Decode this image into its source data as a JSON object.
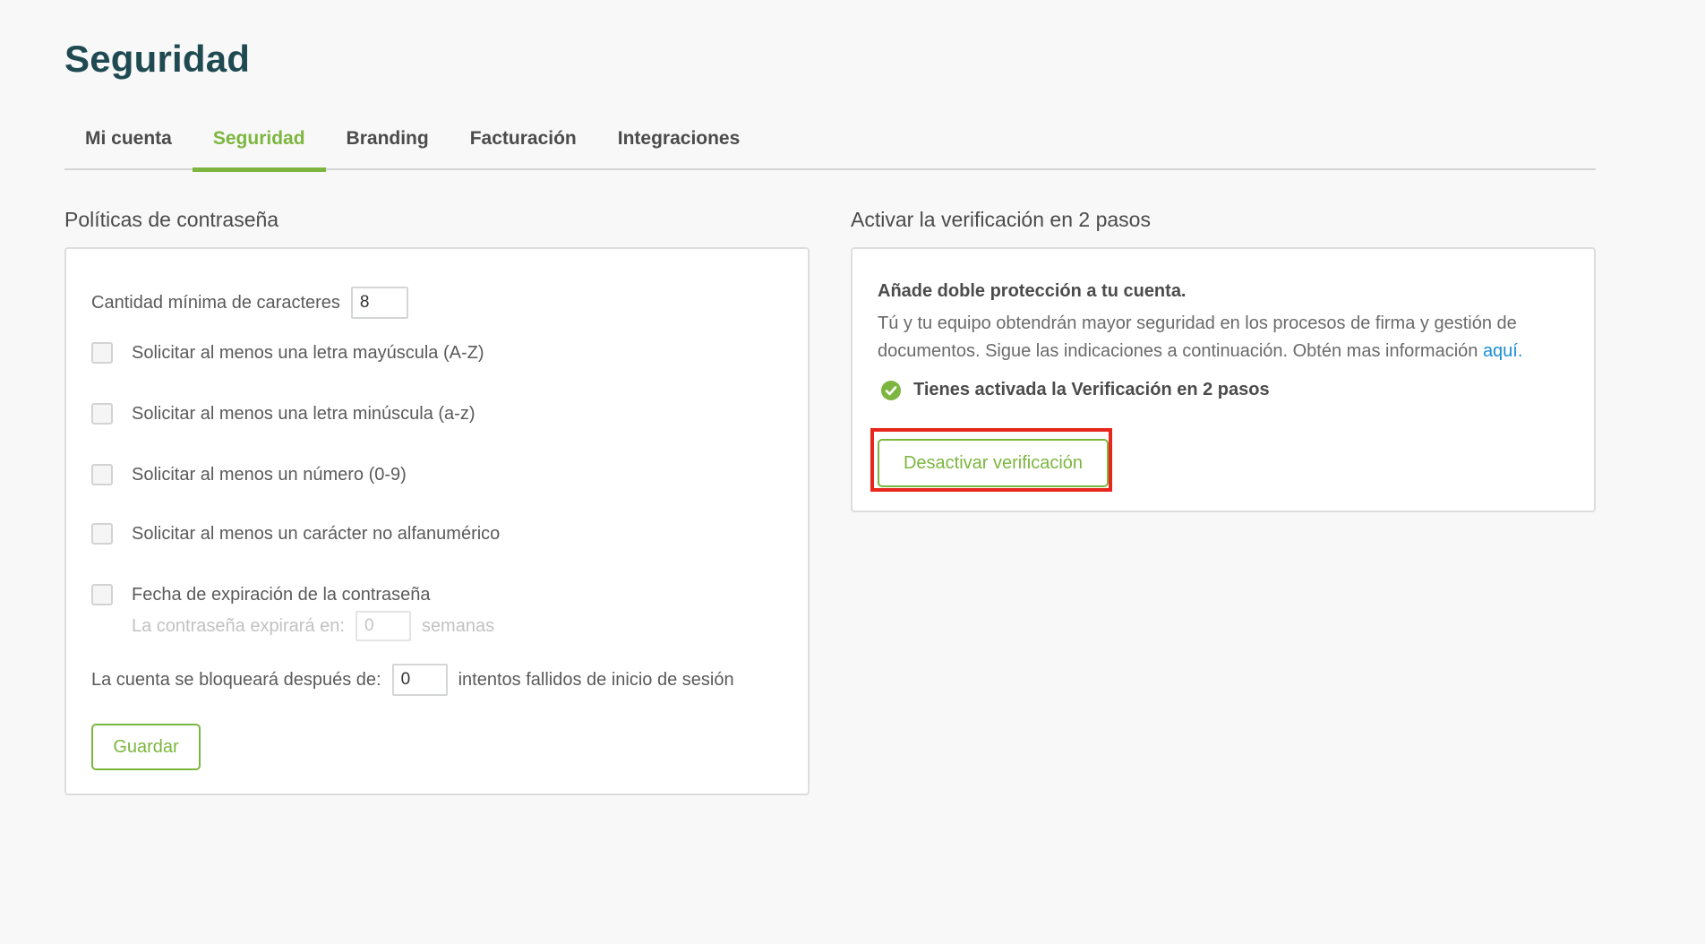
{
  "page": {
    "title": "Seguridad"
  },
  "tabs": [
    {
      "label": "Mi cuenta",
      "active": false
    },
    {
      "label": "Seguridad",
      "active": true
    },
    {
      "label": "Branding",
      "active": false
    },
    {
      "label": "Facturación",
      "active": false
    },
    {
      "label": "Integraciones",
      "active": false
    }
  ],
  "password_policies": {
    "title": "Políticas de contraseña",
    "min_chars_label": "Cantidad mínima de caracteres",
    "min_chars_value": "8",
    "checkboxes": [
      {
        "label": "Solicitar al menos una letra mayúscula (A-Z)",
        "checked": false
      },
      {
        "label": "Solicitar al menos una letra minúscula (a-z)",
        "checked": false
      },
      {
        "label": "Solicitar al menos un número (0-9)",
        "checked": false
      },
      {
        "label": "Solicitar al menos un carácter no alfanumérico",
        "checked": false
      },
      {
        "label": "Fecha de expiración de la contraseña",
        "checked": false
      }
    ],
    "expiry_label": "La contraseña expirará en:",
    "expiry_value": "0",
    "expiry_unit": "semanas",
    "lockout_label": "La cuenta se bloqueará después de:",
    "lockout_value": "0",
    "lockout_suffix": "intentos fallidos de inicio de sesión",
    "save_label": "Guardar"
  },
  "two_step": {
    "title": "Activar la verificación en 2 pasos",
    "heading": "Añade doble protección a tu cuenta.",
    "description": "Tú y tu equipo obtendrán mayor seguridad en los procesos de firma y gestión de documentos. Sigue las indicaciones a continuación. Obtén mas información ",
    "link_text": "aquí.",
    "status": "Tienes activada la Verificación en 2 pasos",
    "deactivate_label": "Desactivar verificación"
  },
  "colors": {
    "accent": "#7cb63f",
    "title": "#1f4a52",
    "link": "#1a8fd6",
    "highlight": "#e8261b"
  }
}
